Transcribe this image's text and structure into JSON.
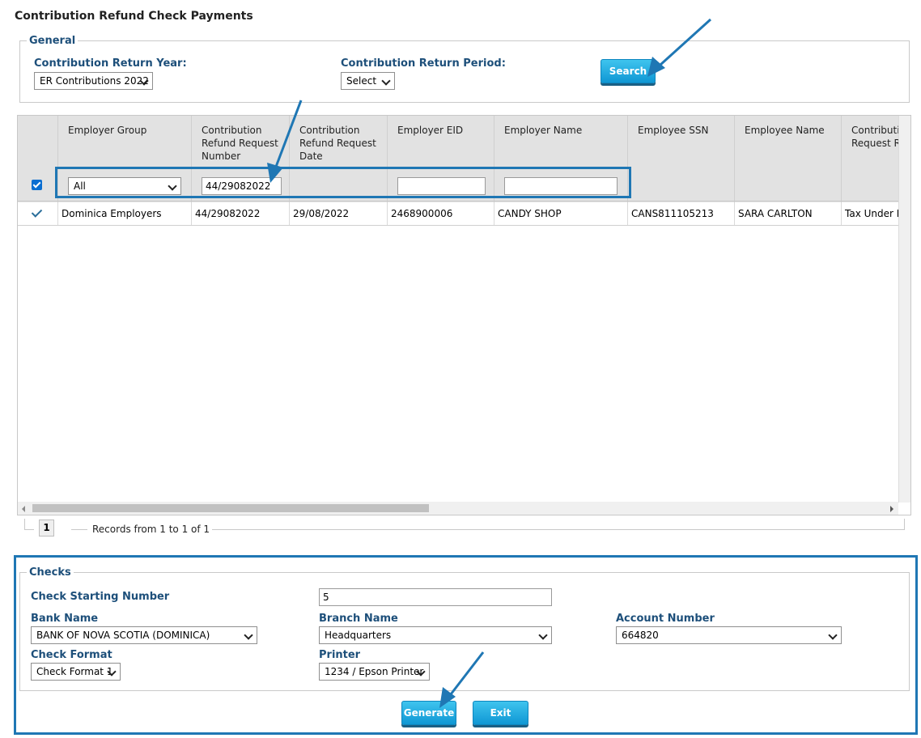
{
  "page": {
    "title": "Contribution Refund Check Payments"
  },
  "general": {
    "legend": "General",
    "year_label": "Contribution Return Year:",
    "year_value": "ER Contributions 2022",
    "period_label": "Contribution Return Period:",
    "period_value": "Select",
    "search_label": "Search"
  },
  "grid": {
    "columns": [
      "Employer Group",
      "Contribution Refund Request Number",
      "Contribution Refund Request Date",
      "Employer EID",
      "Employer Name",
      "Employee SSN",
      "Employee Name",
      "Contribution Request R"
    ],
    "filters": {
      "employer_group": "All",
      "request_number": "44/29082022",
      "employer_eid": "",
      "employer_name": ""
    },
    "rows": [
      {
        "employer_group": "Dominica Employers",
        "request_number": "44/29082022",
        "request_date": "29/08/2022",
        "employer_eid": "2468900006",
        "employer_name": "CANDY SHOP",
        "employee_ssn": "CANS811105213",
        "employee_name": "SARA CARLTON",
        "request_reason": "Tax Under P"
      }
    ]
  },
  "pager": {
    "page": "1",
    "records": "Records from 1 to 1 of 1"
  },
  "checks": {
    "legend": "Checks",
    "starting_label": "Check Starting Number",
    "starting_value": "5",
    "bank_label": "Bank Name",
    "bank_value": "BANK OF NOVA SCOTIA (DOMINICA)",
    "branch_label": "Branch Name",
    "branch_value": "Headquarters",
    "account_label": "Account Number",
    "account_value": "664820",
    "format_label": "Check Format",
    "format_value": "Check Format 1",
    "printer_label": "Printer",
    "printer_value": "1234 / Epson Printer",
    "generate_label": "Generate",
    "exit_label": "Exit"
  },
  "colors": {
    "label_blue": "#1d4f7a",
    "button_blue": "#0f97d4",
    "annotation_blue": "#1f77b4"
  }
}
